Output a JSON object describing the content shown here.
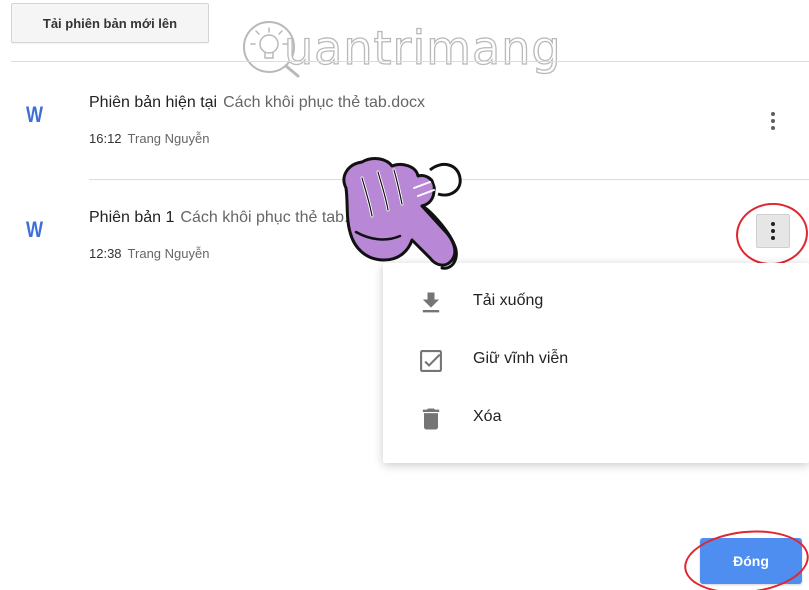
{
  "toolbar": {
    "upload_label": "Tải phiên bản mới lên"
  },
  "watermark": {
    "text": "uantrimang"
  },
  "versions": [
    {
      "icon": "word-doc-icon",
      "icon_letter": "W",
      "label": "Phiên bản hiện tại",
      "file": "Cách khôi phục thẻ tab.docx",
      "time": "16:12",
      "author": "Trang Nguyễn"
    },
    {
      "icon": "word-doc-icon",
      "icon_letter": "W",
      "label": "Phiên bản 1",
      "file": "Cách khôi phục thẻ tab.docx",
      "time": "12:38",
      "author": "Trang Nguyễn"
    }
  ],
  "menu": {
    "items": [
      {
        "label": "Tải xuống",
        "icon": "download-icon"
      },
      {
        "label": "Giữ vĩnh viễn",
        "icon": "checkbox-icon"
      },
      {
        "label": "Xóa",
        "icon": "trash-icon"
      }
    ]
  },
  "footer": {
    "close_label": "Đóng"
  },
  "colors": {
    "accent": "#4d8ef0",
    "word_blue": "#3e6fd8",
    "annotation_red": "#e0262f",
    "hand_purple": "#b07fd0"
  }
}
